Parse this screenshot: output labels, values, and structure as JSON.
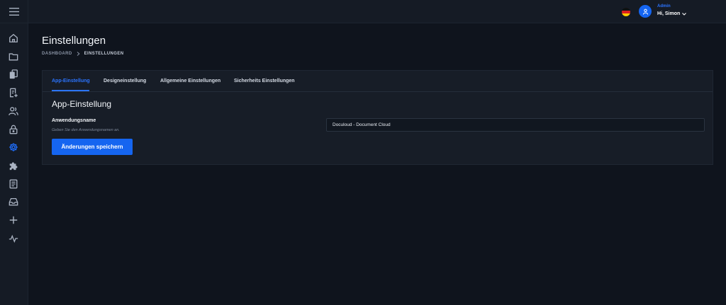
{
  "colors": {
    "accent": "#1565f0",
    "accent_text": "#2b74ff",
    "background": "#0f141d",
    "panel": "#171d27"
  },
  "sidebar": {
    "toggle_icon": "hamburger-icon",
    "items": [
      {
        "icon": "home-icon",
        "active": false
      },
      {
        "icon": "folder-icon",
        "active": false
      },
      {
        "icon": "documents-icon",
        "active": false
      },
      {
        "icon": "file-add-icon",
        "active": false
      },
      {
        "icon": "users-icon",
        "active": false
      },
      {
        "icon": "lock-icon",
        "active": false
      },
      {
        "icon": "gear-icon",
        "active": true
      },
      {
        "icon": "puzzle-icon",
        "active": false
      },
      {
        "icon": "list-document-icon",
        "active": false
      },
      {
        "icon": "inbox-icon",
        "active": false
      },
      {
        "icon": "plus-icon",
        "active": false
      },
      {
        "icon": "activity-icon",
        "active": false
      }
    ]
  },
  "topbar": {
    "language_flag": "de-flag-icon",
    "user": {
      "role": "Admin",
      "greeting": "Hi, Simon"
    }
  },
  "page": {
    "title": "Einstellungen",
    "breadcrumb": {
      "root": "DASHBOARD",
      "current": "EINSTELLUNGEN"
    }
  },
  "tabs": [
    {
      "label": "App-Einstellung",
      "active": true
    },
    {
      "label": "Designeinstellung",
      "active": false
    },
    {
      "label": "Allgemeine Einstellungen",
      "active": false
    },
    {
      "label": "Sicherheits Einstellungen",
      "active": false
    }
  ],
  "section": {
    "title": "App-Einstellung",
    "field_label": "Anwendungsname",
    "field_help": "Geben Sie den Anwendungsnamen an.",
    "field_value": "Doculoud - Document Cloud",
    "save_label": "Änderungen speichern"
  }
}
